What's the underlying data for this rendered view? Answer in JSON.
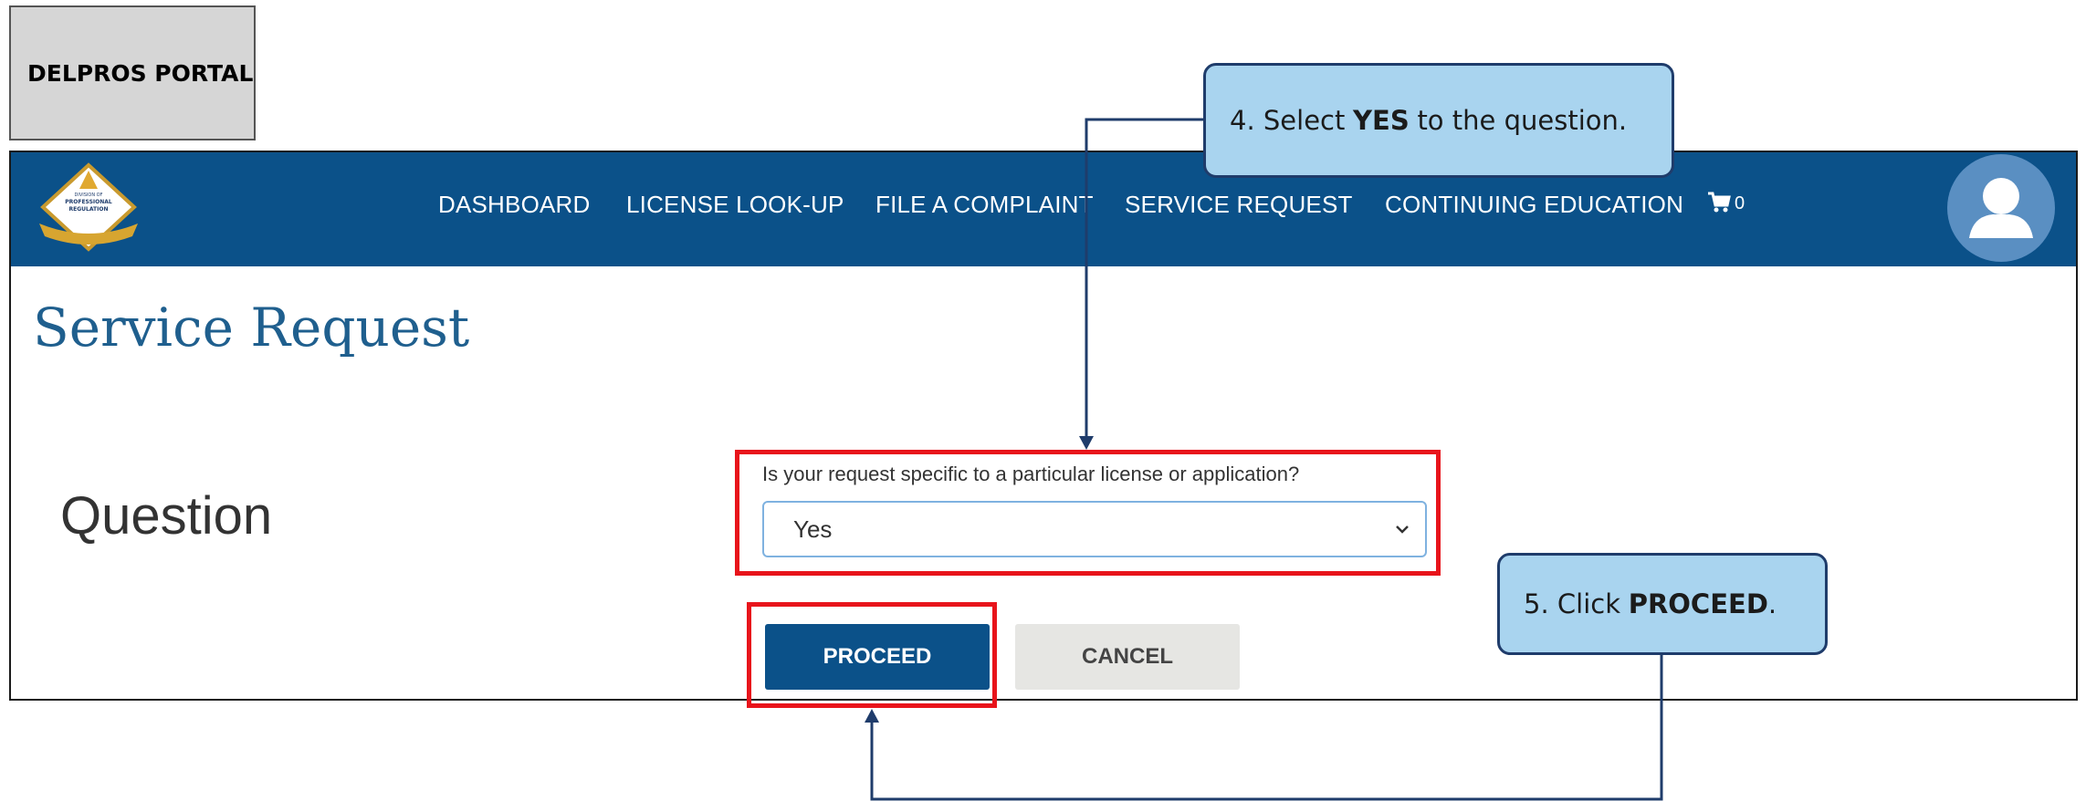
{
  "portal_tag": "DELPROS PORTAL",
  "nav": {
    "items": [
      {
        "label": "DASHBOARD"
      },
      {
        "label": "LICENSE LOOK-UP"
      },
      {
        "label": "FILE A COMPLAINT"
      },
      {
        "label": "SERVICE REQUEST"
      },
      {
        "label": "CONTINUING EDUCATION"
      }
    ],
    "cart_count": "0",
    "logo_text": [
      "DIVISION OF",
      "PROFESSIONAL",
      "REGULATION"
    ]
  },
  "page": {
    "title": "Service Request",
    "section_title": "Question",
    "question_label": "Is your request specific to a particular license or application?",
    "select_value": "Yes",
    "proceed_label": "PROCEED",
    "cancel_label": "CANCEL"
  },
  "callouts": {
    "step4": {
      "pre": "4. Select",
      "bold": "YES",
      "post": "to the question."
    },
    "step5": {
      "pre": "5. Click",
      "bold": "PROCEED",
      "post": "."
    }
  },
  "colors": {
    "nav_bg": "#0b5189",
    "title": "#1f5f8e",
    "highlight": "#e8141b",
    "callout_bg": "#a9d4ef",
    "callout_border": "#1f3c6b"
  }
}
